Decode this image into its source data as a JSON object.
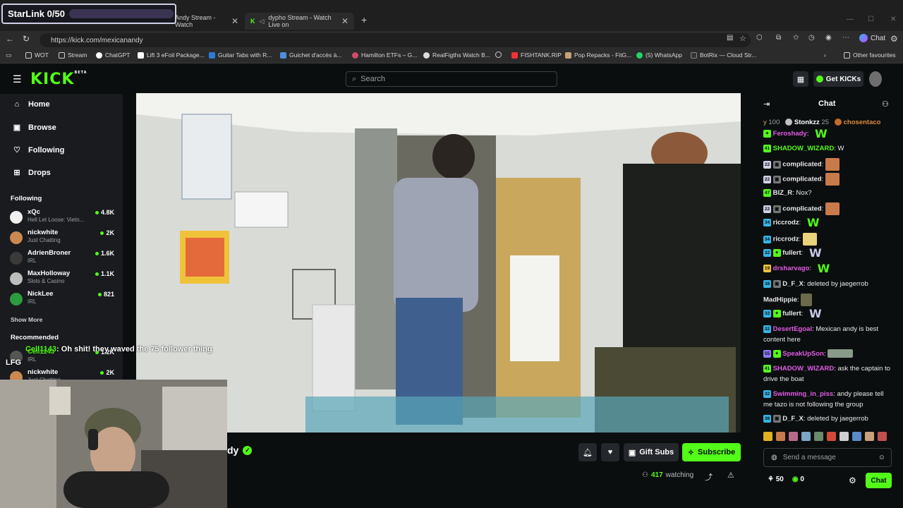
{
  "overlay": {
    "starlink_label": "StarLink 0/50",
    "webcam_text_user": "Cell1143",
    "webcam_text_msg": ": Oh shit! they waved the 75 follower thing",
    "webcam_text_line2": "LFG"
  },
  "browser": {
    "tabs": [
      "Andy Stream - Watch",
      "dypho Stream - Watch Live on"
    ],
    "url": "https://kick.com/mexicanandy",
    "chat_button": "Chat",
    "bookmarks": [
      "WOT",
      "Stream",
      "ChatGPT",
      "Lift 3 eFoil Package...",
      "Guitar Tabs with R...",
      "Guichet d'accès à...",
      "Hamilton ETFs – G...",
      "RealFigths Watch B...",
      "FISHTANK.RIP",
      "Pop Repacks - FitG...",
      "(5) WhatsApp",
      "BotRix — Cloud Str..."
    ],
    "other_favourites": "Other favourites"
  },
  "kick": {
    "logo": "KICK",
    "logo_beta": "BETA",
    "search_placeholder": "Search",
    "get_kicks": "Get KICKs",
    "nav": [
      "Home",
      "Browse",
      "Following",
      "Drops"
    ],
    "following_header": "Following",
    "following": [
      {
        "name": "xQc",
        "category": "Hell Let Loose: Vietn...",
        "viewers": "4.8K"
      },
      {
        "name": "nickwhite",
        "category": "Just Chatting",
        "viewers": "2K"
      },
      {
        "name": "AdrienBroner",
        "category": "IRL",
        "viewers": "1.6K"
      },
      {
        "name": "MaxHolloway",
        "category": "Slots & Casino",
        "viewers": "1.1K"
      },
      {
        "name": "NickLee",
        "category": "IRL",
        "viewers": "821"
      }
    ],
    "show_more": "Show More",
    "recommended_header": "Recommended",
    "recommended": [
      {
        "name": "Cell1143",
        "category": "IRL",
        "viewers": "1.2K"
      },
      {
        "name": "nickwhite",
        "category": "Just Chatting",
        "viewers": "2K"
      }
    ]
  },
  "stream": {
    "name_suffix": "dy",
    "gift_subs": "Gift Subs",
    "subscribe": "Subscribe",
    "watching_count": "417",
    "watching_label": "watching"
  },
  "chat": {
    "title": "Chat",
    "leaderboard": [
      {
        "name": "y",
        "value": "100"
      },
      {
        "name": "Stonkzz",
        "value": "25"
      },
      {
        "name": "chosentaco",
        "value": ""
      }
    ],
    "messages": [
      {
        "badge": "",
        "user": "Feroshady",
        "color": "#e25be6",
        "text": ""
      },
      {
        "badge": "41",
        "user": "SHADOW_WIZARD",
        "color": "#53fc18",
        "text": "W"
      },
      {
        "badge": "22",
        "user": "complicated",
        "color": "#ffffff",
        "text": ""
      },
      {
        "badge": "22",
        "user": "complicated",
        "color": "#ffffff",
        "text": ""
      },
      {
        "badge": "47",
        "user": "BIZ_R",
        "color": "#ffffff",
        "text": "Nox?"
      },
      {
        "badge": "22",
        "user": "complicated",
        "color": "#ffffff",
        "text": ""
      },
      {
        "badge": "34",
        "user": "riccrodz",
        "color": "#ffffff",
        "text": ""
      },
      {
        "badge": "34",
        "user": "riccrodz",
        "color": "#ffffff",
        "text": ""
      },
      {
        "badge": "32",
        "user": "fullert",
        "color": "#ffffff",
        "text": ""
      },
      {
        "badge": "19",
        "user": "drsharvago",
        "color": "#e25be6",
        "text": ""
      },
      {
        "badge": "38",
        "user": "D_F_X",
        "color": "#ffffff",
        "text": "deleted by jaegerrob"
      },
      {
        "badge": "",
        "user": "MadHippie",
        "color": "#ffffff",
        "text": ""
      },
      {
        "badge": "32",
        "user": "fullert",
        "color": "#ffffff",
        "text": ""
      },
      {
        "badge": "32",
        "user": "DesertEgoal",
        "color": "#e25be6",
        "text": "Mexican andy is best content here"
      },
      {
        "badge": "55",
        "user": "SpeakUpSon",
        "color": "#e25be6",
        "text": ""
      },
      {
        "badge": "41",
        "user": "SHADOW_WIZARD",
        "color": "#e25be6",
        "text": "ask the captain to drive the boat"
      },
      {
        "badge": "32",
        "user": "Swimming_in_piss",
        "color": "#e25be6",
        "text": "andy please tell me tazo is not following the group"
      },
      {
        "badge": "38",
        "user": "D_F_X",
        "color": "#ffffff",
        "text": "deleted by jaegerrob"
      }
    ],
    "send_placeholder": "Send a message",
    "points": "50",
    "kicks": "0",
    "chat_button": "Chat"
  }
}
